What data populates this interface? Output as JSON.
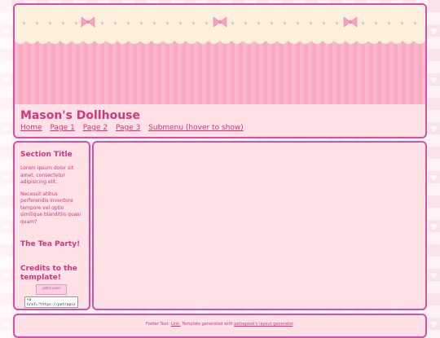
{
  "header": {
    "title": "Mason's Dollhouse",
    "nav": [
      "Home",
      "Page 1",
      "Page 2",
      "Page 3",
      "Submenu (hover to show)"
    ]
  },
  "sidebar": {
    "section_title": "Section Title",
    "para1": "Lorem ipsum dolor sit amet, consectetur adipisicing elit.",
    "para2": "Necessit atibus perferendis inventore tempore vel optio similique blanditiis quasi quam?",
    "tea_party_title": "The Tea Party!",
    "credits_title": "Credits to the template!",
    "badge_text": "petra pixel",
    "code_box_text": "<a\nhref=\"https://petrapix"
  },
  "footer": {
    "text_before": "Footer Text. ",
    "link1": "Link.",
    "text_middle": " Template generated with ",
    "link2": "petrapixel's layout generator",
    "text_after": "."
  },
  "colors": {
    "accent": "#d8347e",
    "border": "#d94ea6",
    "panel_bg": "#ffe1e6",
    "stripe_light": "#fbb8cd",
    "stripe_dark": "#f9a9c0",
    "cream": "#fff0de"
  },
  "icons": [
    "heart-icon",
    "bow-icon"
  ]
}
